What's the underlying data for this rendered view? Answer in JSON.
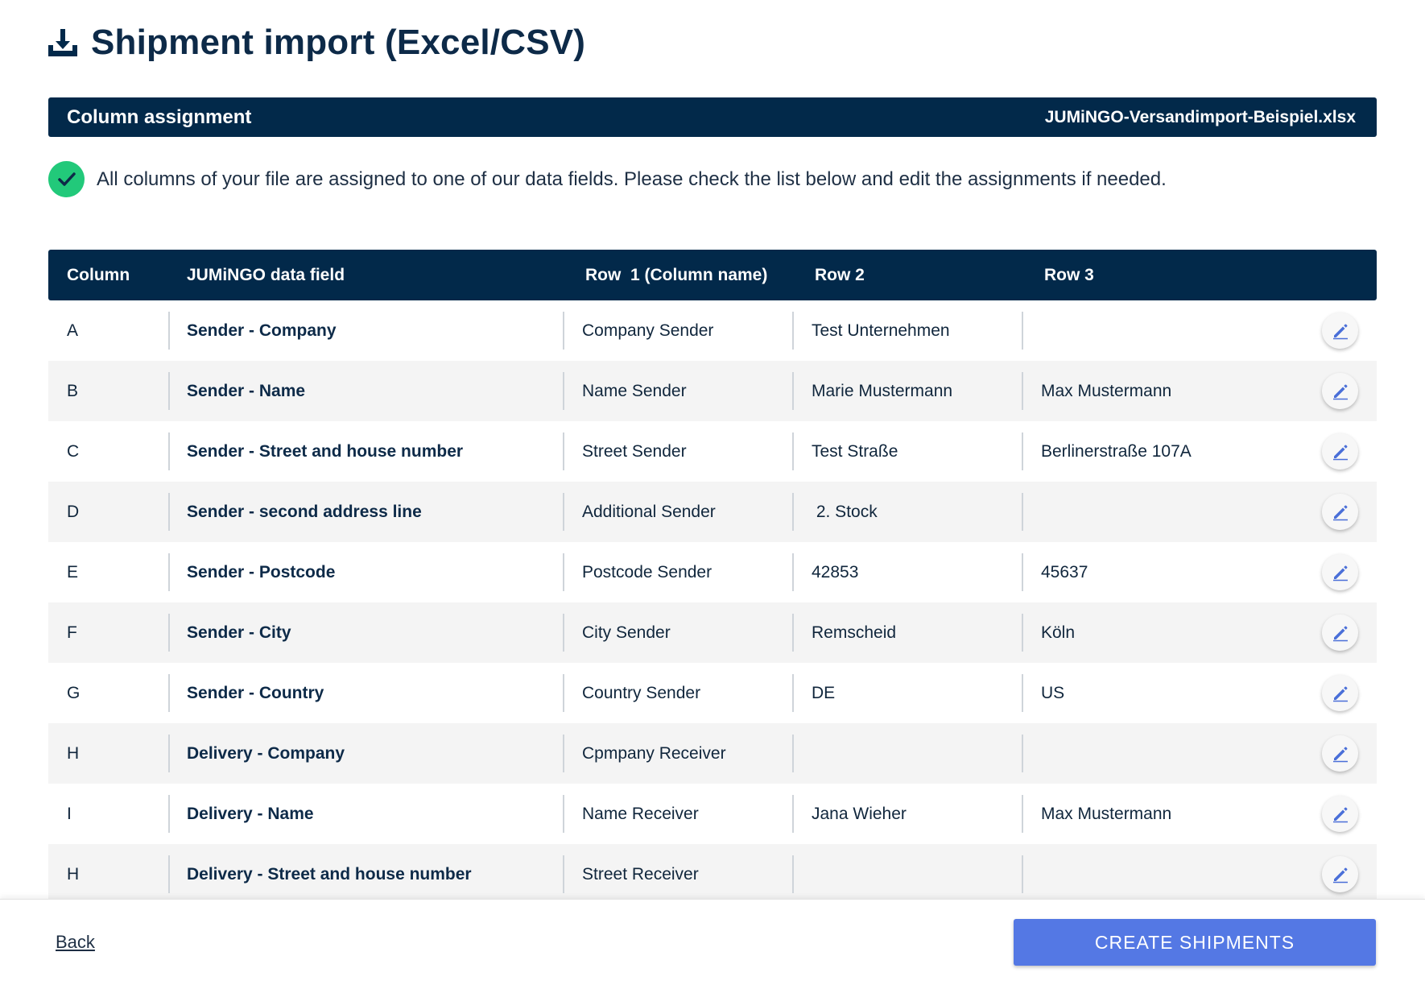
{
  "header": {
    "icon": "download-tray-icon",
    "title": "Shipment import (Excel/CSV)"
  },
  "assignment_bar": {
    "title": "Column assignment",
    "file_name": "JUMiNGO-Versandimport-Beispiel.xlsx"
  },
  "notice": {
    "icon": "check-circle-icon",
    "text": "All columns of your file are assigned to one of our data fields. Please check the list below and edit the assignments if needed.",
    "color": "#22c97a"
  },
  "table": {
    "headers": {
      "column": "Column",
      "field": "JUMiNGO data field",
      "row1": "Row  1 (Column name)",
      "row2": "Row 2",
      "row3": "Row 3"
    },
    "rows": [
      {
        "column": "A",
        "field": "Sender - Company",
        "row1": "Company Sender",
        "row2": "Test Unternehmen",
        "row3": ""
      },
      {
        "column": "B",
        "field": "Sender - Name",
        "row1": "Name Sender",
        "row2": "Marie Mustermann",
        "row3": "Max Mustermann"
      },
      {
        "column": "C",
        "field": "Sender - Street and house number",
        "row1": "Street Sender",
        "row2": "Test Straße",
        "row3": "Berlinerstraße 107A"
      },
      {
        "column": "D",
        "field": "Sender - second address line",
        "row1": "Additional Sender",
        "row2": " 2. Stock",
        "row3": ""
      },
      {
        "column": "E",
        "field": "Sender - Postcode",
        "row1": "Postcode Sender",
        "row2": "42853",
        "row3": "45637"
      },
      {
        "column": "F",
        "field": "Sender - City",
        "row1": "City Sender",
        "row2": "Remscheid",
        "row3": "Köln"
      },
      {
        "column": "G",
        "field": "Sender - Country",
        "row1": "Country Sender",
        "row2": "DE",
        "row3": "US"
      },
      {
        "column": "H",
        "field": "Delivery - Company",
        "row1": "Cpmpany Receiver",
        "row2": "",
        "row3": ""
      },
      {
        "column": "I",
        "field": "Delivery - Name",
        "row1": "Name Receiver",
        "row2": "Jana Wieher",
        "row3": "Max Mustermann"
      },
      {
        "column": "H",
        "field": "Delivery - Street and house number",
        "row1": "Street Receiver",
        "row2": "",
        "row3": ""
      }
    ],
    "edit_icon": "pencil-icon"
  },
  "footer": {
    "back_label": "Back",
    "create_label": "CREATE SHIPMENTS",
    "accent": "#5478e4"
  },
  "colors": {
    "navy": "#02294a"
  }
}
